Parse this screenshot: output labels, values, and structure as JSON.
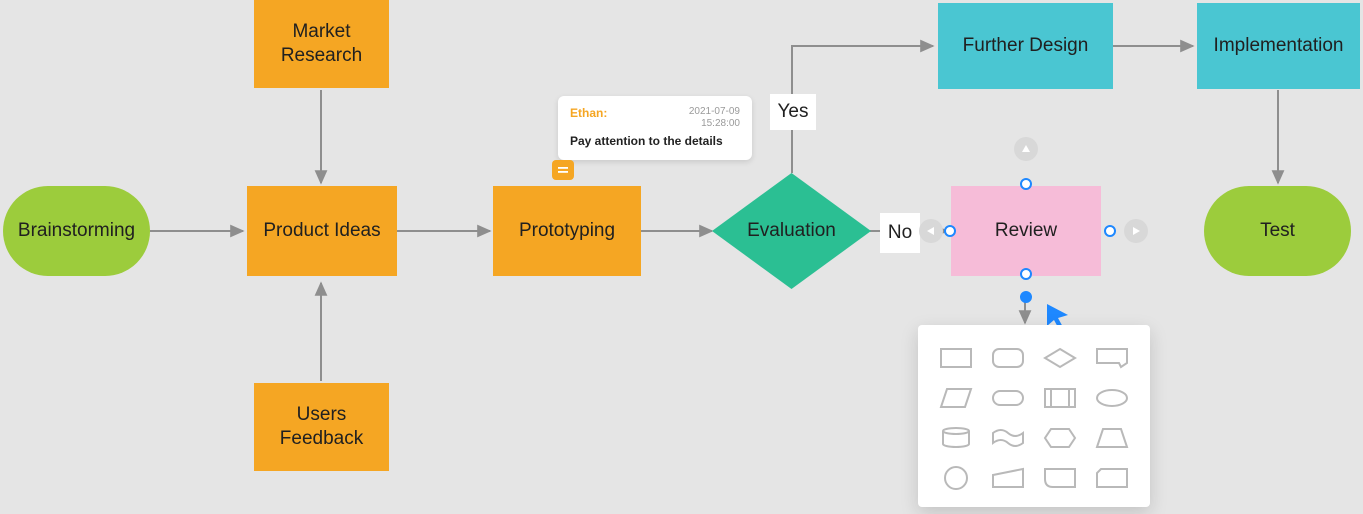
{
  "nodes": {
    "brainstorming": "Brainstorming",
    "market_research": "Market\nResearch",
    "product_ideas": "Product Ideas",
    "users_feedback": "Users\nFeedback",
    "prototyping": "Prototyping",
    "evaluation": "Evaluation",
    "review": "Review",
    "further_design": "Further Design",
    "implementation": "Implementation",
    "test": "Test"
  },
  "edge_labels": {
    "yes": "Yes",
    "no": "No"
  },
  "comment": {
    "author": "Ethan:",
    "date": "2021-07-09",
    "time": "15:28:00",
    "body": "Pay attention to the details"
  },
  "colors": {
    "terminator": "#9ccc3c",
    "process": "#f5a623",
    "decision": "#2bbf93",
    "info": "#4ac6d2",
    "selected": "#f6bcd8",
    "accent": "#1e88ff"
  },
  "shape_picker": {
    "shapes": [
      "rectangle",
      "rounded-rectangle",
      "diamond",
      "callout",
      "parallelogram",
      "capsule",
      "predefined-process",
      "ellipse",
      "cylinder",
      "flag",
      "hexagon",
      "trapezoid",
      "circle",
      "manual-input",
      "rounded-rect-small",
      "card"
    ]
  }
}
